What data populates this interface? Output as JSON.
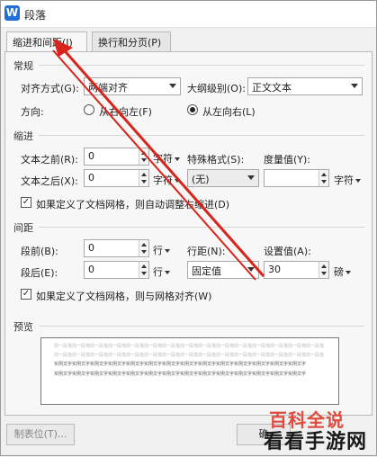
{
  "window": {
    "title": "段落",
    "app_icon_letter": "W"
  },
  "tabs": [
    {
      "label": "缩进和间距(I)",
      "active": true
    },
    {
      "label": "换行和分页(P)",
      "active": false
    }
  ],
  "general": {
    "section": "常规",
    "align_label": "对齐方式(G):",
    "align_value": "两端对齐",
    "outline_label": "大纲级别(O):",
    "outline_value": "正文文本",
    "direction_label": "方向:",
    "dir_rtl": "从右向左(F)",
    "dir_ltr": "从左向右(L)",
    "direction_selected": "ltr"
  },
  "indent": {
    "section": "缩进",
    "before_label": "文本之前(R):",
    "before_value": "0",
    "before_unit": "字符",
    "special_label": "特殊格式(S):",
    "special_value": "(无)",
    "measure_label": "度量值(Y):",
    "measure_value": "",
    "measure_unit": "字符",
    "after_label": "文本之后(X):",
    "after_value": "0",
    "after_unit": "字符",
    "auto_adjust_label": "如果定义了文档网格，则自动调整右缩进(D)",
    "auto_adjust_checked": true
  },
  "spacing": {
    "section": "间距",
    "before_label": "段前(B):",
    "before_value": "0",
    "before_unit": "行",
    "line_label": "行距(N):",
    "line_value": "固定值",
    "setting_label": "设置值(A):",
    "setting_value": "30",
    "setting_unit": "磅",
    "after_label": "段后(E):",
    "after_value": "0",
    "after_unit": "行",
    "snap_label": "如果定义了文档网格，则与网格对齐(W)",
    "snap_checked": true
  },
  "preview": {
    "section": "预览",
    "prev_line": "前一段落前一段落前一段落前一段落前一段落前一段落前一段落前一段落前一段落前一段落前一段落前一段落前一段落前一段落前一段落",
    "sample_line": "实例文字实例文字实例文字实例文字实例文字实例文字实例文字实例文字实例文字实例文字实例文字实例文字实例文字实例文字"
  },
  "buttons": {
    "tab_stops": "制表位(T)...",
    "ok": "确"
  },
  "watermark": {
    "line1": "百科全说",
    "line2": "看看手游网"
  },
  "colors": {
    "arrow": "#d9241b",
    "brand_icon": "#1f6fd6"
  }
}
